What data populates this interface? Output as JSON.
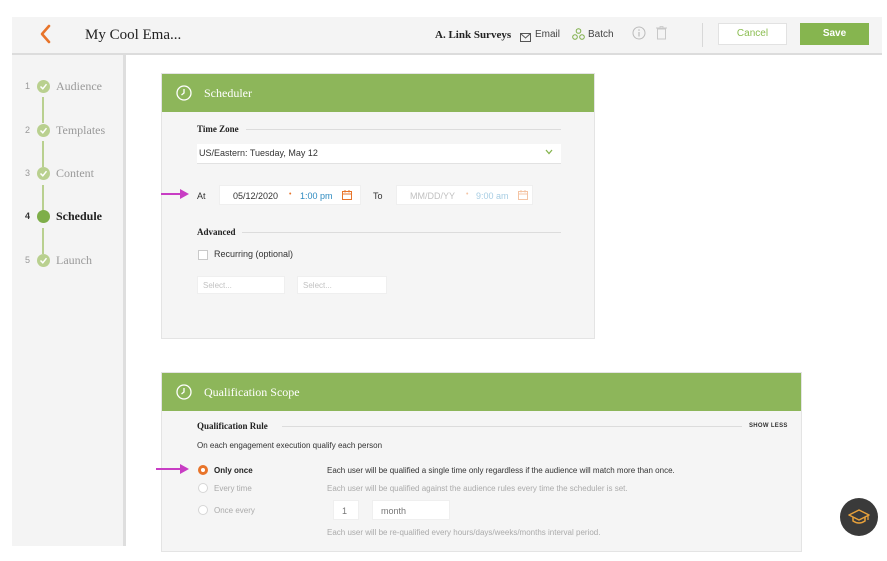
{
  "header": {
    "email_name": "My Cool Ema...",
    "list_name": "A. Link Surveys",
    "email_label": "Email",
    "batch_label": "Batch",
    "cancel_label": "Cancel",
    "save_label": "Save"
  },
  "steps": [
    {
      "num": "1",
      "label": "Audience"
    },
    {
      "num": "2",
      "label": "Templates"
    },
    {
      "num": "3",
      "label": "Content"
    },
    {
      "num": "4",
      "label": "Schedule"
    },
    {
      "num": "5",
      "label": "Launch"
    }
  ],
  "scheduler": {
    "title": "Scheduler",
    "time_zone_label": "Time Zone",
    "time_zone_value": "US/Eastern: Tuesday, May 12",
    "at_label": "At",
    "at_date": "05/12/2020",
    "at_time": "1:00 pm",
    "to_label": "To",
    "to_date_placeholder": "MM/DD/YY",
    "to_time_placeholder": "9:00 am",
    "advanced_label": "Advanced",
    "recurring_label": "Recurring (optional)",
    "select1_placeholder": "Select...",
    "select2_placeholder": "Select..."
  },
  "qualification": {
    "title": "Qualification Scope",
    "rule_label": "Qualification Rule",
    "show_less": "SHOW LESS",
    "intro": "On each engagement execution qualify each person",
    "options": [
      {
        "label": "Only once",
        "desc": "Each user will be qualified a single time only regardless if the audience will match more than once."
      },
      {
        "label": "Every time",
        "desc": "Each user will be qualified against the audience rules every time the scheduler is set."
      },
      {
        "label": "Once every",
        "desc": "Each user will be re-qualified every hours/days/weeks/months interval period."
      }
    ],
    "interval_value": "1",
    "interval_unit": "month"
  },
  "colors": {
    "accent_green": "#8db65a",
    "accent_orange": "#e8742a",
    "arrow_magenta": "#c83dc4"
  }
}
